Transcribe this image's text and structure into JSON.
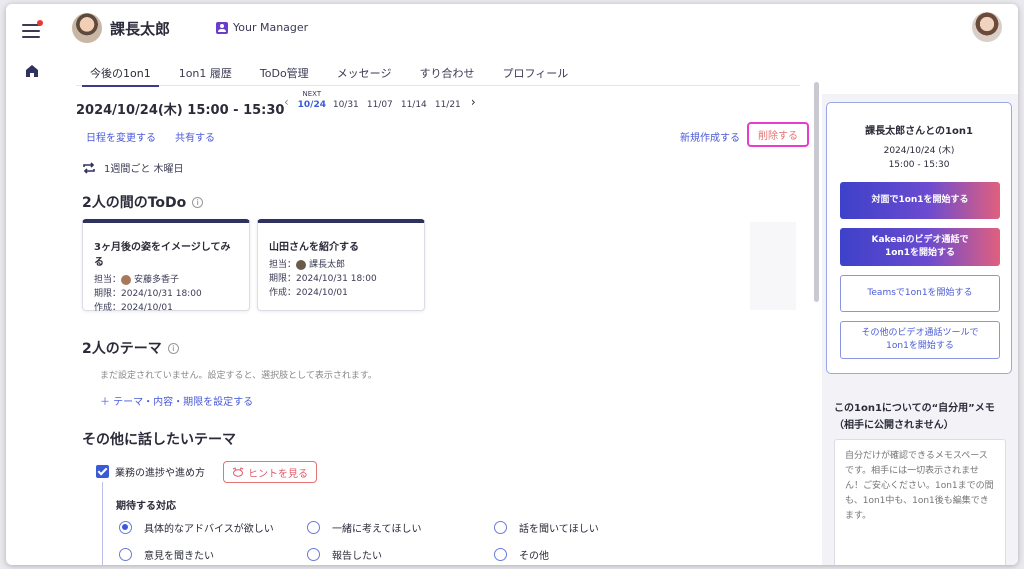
{
  "header": {
    "user_name": "課長太郎",
    "role_badge": "Your Manager"
  },
  "tabs": [
    "今後の1on1",
    "1on1 履歴",
    "ToDo管理",
    "メッセージ",
    "すり合わせ",
    "プロフィール"
  ],
  "schedule": {
    "current_datetime": "2024/10/24(木)  15:00 - 15:30",
    "next_label": "NEXT",
    "dates": [
      "10/24",
      "10/31",
      "11/07",
      "11/14",
      "11/21"
    ],
    "active_date": "10/24",
    "reschedule_link": "日程を変更する",
    "share_link": "共有する",
    "new_link": "新規作成する",
    "delete_button": "削除する",
    "recurrence": "1週間ごと 木曜日"
  },
  "todo_section": {
    "title": "2人の間のToDo",
    "cards": [
      {
        "title": "3ヶ月後の姿をイメージしてみる",
        "assignee_label": "担当：",
        "assignee": "安藤多香子",
        "due": "期限：2024/10/31 18:00",
        "created": "作成：2024/10/01"
      },
      {
        "title": "山田さんを紹介する",
        "assignee_label": "担当：",
        "assignee": "課長太郎",
        "due": "期限：2024/10/31 18:00",
        "created": "作成：2024/10/01"
      }
    ]
  },
  "theme_section": {
    "title": "2人のテーマ",
    "empty_note": "まだ設定されていません。設定すると、選択肢として表示されます。",
    "add_link": "＋  テーマ・内容・期限を設定する"
  },
  "other_section": {
    "title": "その他に話したいテーマ",
    "checkbox_label": "業務の進捗や進め方",
    "hint_button": "ヒントを見る",
    "expect_label": "期待する対応",
    "options": [
      "具体的なアドバイスが欲しい",
      "一緒に考えてほしい",
      "話を聞いてほしい",
      "意見を聞きたい",
      "報告したい",
      "その他"
    ],
    "selected_option": "具体的なアドバイスが欲しい"
  },
  "side_panel": {
    "title": "課長太郎さんとの1on1",
    "date": "2024/10/24 (木)",
    "time": "15:00 - 15:30",
    "btn_in_person": "対面で1on1を開始する",
    "btn_kakeai_line1": "Kakeaiのビデオ通話で",
    "btn_kakeai_line2": "1on1を開始する",
    "btn_teams": "Teamsで1on1を開始する",
    "btn_other_line1": "その他のビデオ通話ツールで",
    "btn_other_line2": "1on1を開始する",
    "memo_title_line1": "この1on1についての“自分用”メモ",
    "memo_title_line2": "（相手に公開されません）",
    "memo_placeholder": "自分だけが確認できるメモスペースです。相手には一切表示されません！ご安心ください。1on1までの間も、1on1中も、1on1後も編集できます。"
  },
  "colors": {
    "accent": "#3b5bd6",
    "delete_highlight": "#e83ccf",
    "gradient_start": "#3d41c9",
    "gradient_end": "#e0607e"
  },
  "icons": [
    "menu-icon",
    "home-icon",
    "manager-icon",
    "repeat-icon",
    "info-icon",
    "hint-icon"
  ]
}
